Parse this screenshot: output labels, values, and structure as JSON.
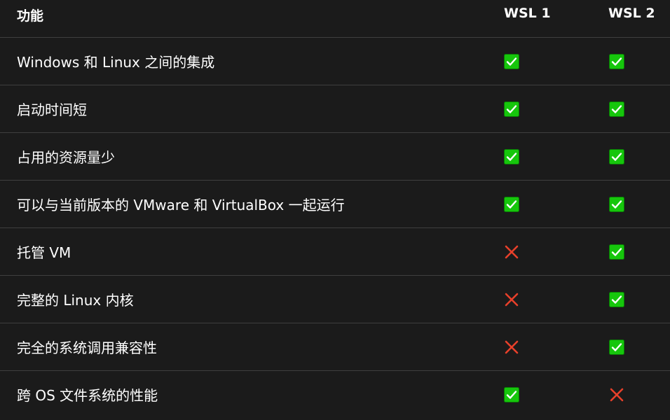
{
  "header": {
    "feature": "功能",
    "wsl1": "WSL 1",
    "wsl2": "WSL 2"
  },
  "rows": [
    {
      "feature": "Windows 和 Linux 之间的集成",
      "wsl1": "check",
      "wsl2": "check"
    },
    {
      "feature": "启动时间短",
      "wsl1": "check",
      "wsl2": "check"
    },
    {
      "feature": "占用的资源量少",
      "wsl1": "check",
      "wsl2": "check"
    },
    {
      "feature": "可以与当前版本的 VMware 和 VirtualBox 一起运行",
      "wsl1": "check",
      "wsl2": "check"
    },
    {
      "feature": "托管 VM",
      "wsl1": "cross",
      "wsl2": "check"
    },
    {
      "feature": "完整的 Linux 内核",
      "wsl1": "cross",
      "wsl2": "check"
    },
    {
      "feature": "完全的系统调用兼容性",
      "wsl1": "cross",
      "wsl2": "check"
    },
    {
      "feature": "跨 OS 文件系统的性能",
      "wsl1": "check",
      "wsl2": "cross"
    }
  ],
  "colors": {
    "background": "#1b1b1b",
    "divider": "#3f3f3f",
    "check_fill": "#16c60c",
    "cross_color": "#e8402a"
  }
}
